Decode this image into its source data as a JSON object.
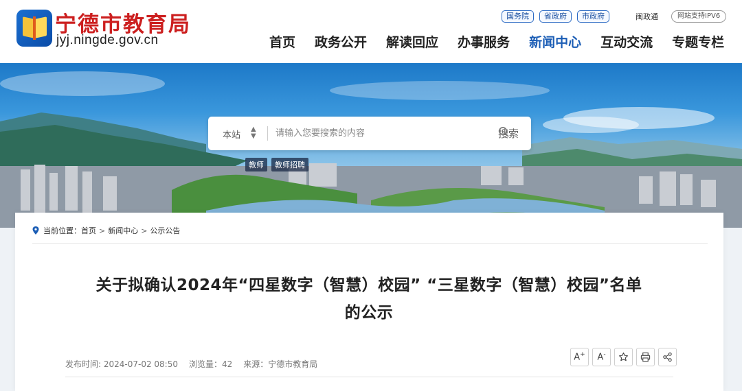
{
  "header": {
    "site_name": "宁德市教育局",
    "site_domain": "jyj.ningde.gov.cn",
    "gov_links": [
      "国务院",
      "省政府",
      "市政府"
    ],
    "mintong": "闽政通",
    "ipv6": "网站支持IPV6",
    "nav": [
      {
        "label": "首页",
        "active": false
      },
      {
        "label": "政务公开",
        "active": false
      },
      {
        "label": "解读回应",
        "active": false
      },
      {
        "label": "办事服务",
        "active": false
      },
      {
        "label": "新闻中心",
        "active": true
      },
      {
        "label": "互动交流",
        "active": false
      },
      {
        "label": "专题专栏",
        "active": false
      }
    ]
  },
  "search": {
    "scope": "本站",
    "placeholder": "请输入您要搜索的内容",
    "button": "搜索",
    "hot_tags": [
      "教师",
      "教师招聘"
    ]
  },
  "breadcrumb": {
    "prefix": "当前位置：",
    "items": [
      "首页",
      "新闻中心",
      "公示公告"
    ]
  },
  "article": {
    "title_line1": "关于拟确认2024年“四星数字（智慧）校园” “三星数字（智慧）校园”名单",
    "title_line2": "的公示",
    "publish_time": "发布时间: 2024-07-02 08:50",
    "views": "浏览量：42",
    "source": "来源：宁德市教育局"
  },
  "tools": {
    "font_larger": "A",
    "font_larger_sup": "+",
    "font_smaller": "A",
    "font_smaller_sup": "-"
  },
  "colors": {
    "brand_red": "#cc1f1f",
    "nav_active": "#1b5db5",
    "gov_link_border": "#2d6bc4"
  }
}
